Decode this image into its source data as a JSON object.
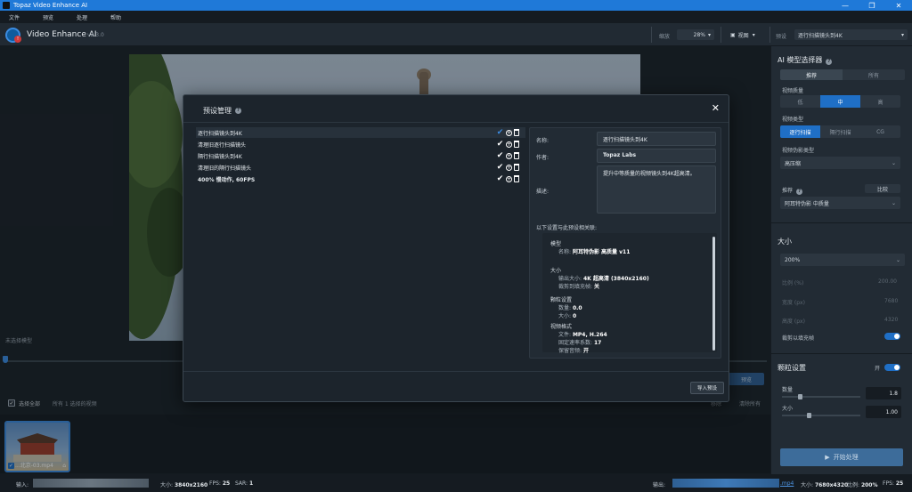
{
  "window": {
    "title": "Topaz Video Enhance AI",
    "min": "—",
    "max": "❐",
    "close": "✕"
  },
  "menu": [
    "文件",
    "预览",
    "处理",
    "帮助"
  ],
  "toolbar": {
    "app_name": "Video Enhance AI",
    "version": "v2.3.0",
    "badge": "!",
    "zoom_label": "缩放",
    "zoom_value": "28%",
    "view_label": "视图",
    "preset_label": "预设",
    "preset_value": "逐行扫描镜头到4K"
  },
  "viewer": {
    "no_model": "未选择模型"
  },
  "controls": {
    "select_all": "选择全部",
    "count_text": "所有 1 选择的视频",
    "preview_btn": "预览",
    "clear_btn": "清除所有",
    "remove_btn": "移除"
  },
  "file": {
    "name": "...北京-03.mp4"
  },
  "sidebar": {
    "ai_title": "AI 模型选择器",
    "tabs": [
      "推荐",
      "所有"
    ],
    "quality_label": "视频质量",
    "quality_opts": [
      "低",
      "中",
      "高"
    ],
    "type_label": "视频类型",
    "type_opts": [
      "逐行扫描",
      "隔行扫描",
      "CG"
    ],
    "artifact_label": "视频伪影类型",
    "artifact_value": "高压缩",
    "recommend_label": "推荐",
    "compare_btn": "比较",
    "recommend_value": "阿耳特伪影 中质量",
    "size_title": "大小",
    "size_value": "200%",
    "dim_rows": [
      "比例 (%)",
      "宽度 (px)",
      "高度 (px)"
    ],
    "dim_vals": [
      "200.00",
      "7680",
      "4320"
    ],
    "crop_label": "裁剪以填充帧",
    "grain_title": "颗粒设置",
    "grain_toggle": "开",
    "amount_label": "数量",
    "amount_value": "1.8",
    "grain_size_label": "大小",
    "grain_size_value": "1.00",
    "start_btn": "开始处理"
  },
  "status": {
    "input_label": "输入:",
    "input_size": "大小: ",
    "input_size_val": "3840x2160",
    "input_fps": "FPS: ",
    "input_fps_val": "25",
    "input_sar": "SAR: ",
    "input_sar_val": "1",
    "output_label": "输出:",
    "output_ext": ".mp4",
    "output_size": "大小: ",
    "output_size_val": "7680x4320",
    "output_ratio": "比例: ",
    "output_ratio_val": "200%",
    "output_fps": "FPS: ",
    "output_fps_val": "25"
  },
  "modal": {
    "title": "预设管理",
    "presets": [
      "逐行扫描镜头到4K",
      "清理旧逐行扫描镜头",
      "隔行扫描镜头到4K",
      "清理旧的隔行扫描镜头",
      "400% 慢动作, 60FPS"
    ],
    "name_label": "名称:",
    "name_value": "逐行扫描镜头到4K",
    "author_label": "作者:",
    "author_value": "Topaz Labs",
    "desc_label": "描述:",
    "desc_value": "提升中等质量的视频镜头到4K超高清。",
    "assoc_label": "以下设置与此预设相关联:",
    "settings": {
      "model_h": "模型",
      "model_k": "名称: ",
      "model_v": "阿耳特伪影 高质量 v11",
      "size_h": "大小",
      "size_k1": "输出大小: ",
      "size_v1": "4K 超高清 (3840x2160)",
      "size_k2": "裁剪到填充帧: ",
      "size_v2": "关",
      "grain_h": "颗粒设置",
      "grain_k1": "数量: ",
      "grain_v1": "0.0",
      "grain_k2": "大小: ",
      "grain_v2": "0",
      "fmt_h": "视频格式",
      "fmt_k1": "文件: ",
      "fmt_v1": "MP4, H.264",
      "fmt_k2": "固定速率系数: ",
      "fmt_v2": "17",
      "fmt_k3": "保留音频: ",
      "fmt_v3": "开"
    },
    "import_btn": "导入预设"
  }
}
